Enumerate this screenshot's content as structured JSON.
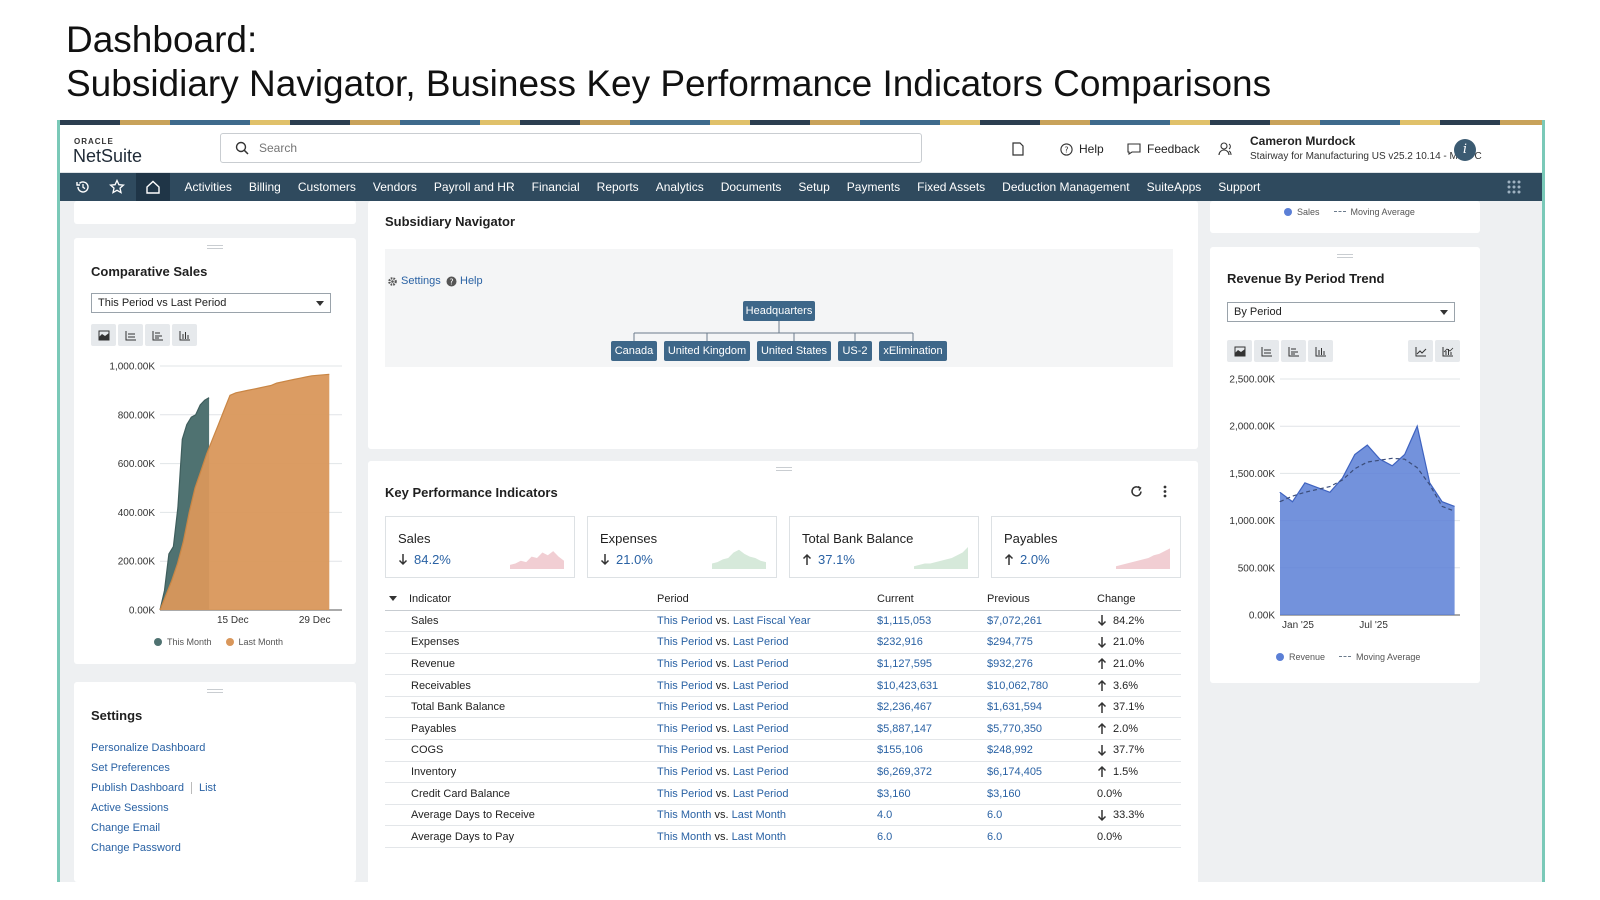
{
  "slide": {
    "title_line1": "Dashboard:",
    "title_line2": "Subsidiary Navigator, Business Key Performance Indicators Comparisons"
  },
  "header": {
    "brand_small": "ORACLE",
    "brand": "NetSuite",
    "search_placeholder": "Search",
    "help_label": "Help",
    "feedback_label": "Feedback",
    "user_name": "Cameron Murdock",
    "user_context": "Stairway for Manufacturing US v25.2 10.14 - MFG C"
  },
  "nav": {
    "items": [
      "Activities",
      "Billing",
      "Customers",
      "Vendors",
      "Payroll and HR",
      "Financial",
      "Reports",
      "Analytics",
      "Documents",
      "Setup",
      "Payments",
      "Fixed Assets",
      "Deduction Management",
      "SuiteApps",
      "Support"
    ]
  },
  "comparative_sales": {
    "title": "Comparative Sales",
    "filter": "This Period vs Last Period",
    "legend": [
      "This Month",
      "Last Month"
    ],
    "colors": {
      "this_month": "#4f7271",
      "last_month": "#d9975b"
    }
  },
  "chart_data": [
    {
      "type": "area",
      "title": "Comparative Sales",
      "y_ticks": [
        "1,000.00K",
        "800.00K",
        "600.00K",
        "400.00K",
        "200.00K",
        "0.00K"
      ],
      "x_ticks": [
        "15 Dec",
        "29 Dec"
      ],
      "ylim": [
        0,
        1000
      ],
      "series": [
        {
          "name": "This Month",
          "values": [
            0,
            80,
            230,
            260,
            420,
            700,
            760,
            790,
            800,
            840,
            860,
            870
          ]
        },
        {
          "name": "Last Month",
          "values": [
            0,
            60,
            120,
            190,
            280,
            400,
            500,
            570,
            640,
            700,
            760,
            820,
            880,
            890,
            895,
            900,
            905,
            910,
            915,
            920,
            930,
            935,
            940,
            945,
            950,
            955,
            960,
            962,
            964,
            966
          ]
        }
      ]
    },
    {
      "type": "area",
      "title": "Revenue By Period Trend",
      "y_ticks": [
        "2,500.00K",
        "2,000.00K",
        "1,500.00K",
        "1,000.00K",
        "500.00K",
        "0.00K"
      ],
      "x_ticks": [
        "Jan '25",
        "Jul '25"
      ],
      "ylim": [
        0,
        2500
      ],
      "series": [
        {
          "name": "Revenue",
          "values": [
            1300,
            1200,
            1400,
            1350,
            1300,
            1450,
            1700,
            1800,
            1650,
            1580,
            1700,
            2000,
            1400,
            1200,
            1150
          ]
        },
        {
          "name": "Moving Average",
          "values": [
            1200,
            1260,
            1300,
            1330,
            1360,
            1430,
            1550,
            1620,
            1640,
            1660,
            1650,
            1560,
            1380,
            1150,
            1100
          ]
        }
      ]
    }
  ],
  "top_legend": [
    "Sales",
    "Moving Average"
  ],
  "settings": {
    "title": "Settings",
    "links": [
      "Personalize Dashboard",
      "Set Preferences",
      "Publish Dashboard",
      "List",
      "Active Sessions",
      "Change Email",
      "Change Password"
    ]
  },
  "subsidiary": {
    "title": "Subsidiary Navigator",
    "settings_link": "Settings",
    "help_link": "Help",
    "root": "Headquarters",
    "children": [
      "Canada",
      "United Kingdom",
      "United States",
      "US-2",
      "xElimination"
    ]
  },
  "kpi": {
    "title": "Key Performance Indicators",
    "cards": [
      {
        "name": "Sales",
        "value": "84.2%",
        "dir": "down",
        "color": "#c93a4e"
      },
      {
        "name": "Expenses",
        "value": "21.0%",
        "dir": "down",
        "color": "#5aa86a"
      },
      {
        "name": "Total Bank Balance",
        "value": "37.1%",
        "dir": "up",
        "color": "#5aa86a"
      },
      {
        "name": "Payables",
        "value": "2.0%",
        "dir": "up",
        "color": "#c93a4e"
      }
    ],
    "columns": [
      "Indicator",
      "Period",
      "Current",
      "Previous",
      "Change"
    ],
    "vs": "vs.",
    "rows": [
      {
        "indicator": "Sales",
        "p1": "This Period",
        "p2": "Last Fiscal Year",
        "current": "$1,115,053",
        "previous": "$7,072,261",
        "dir": "down",
        "change": "84.2%"
      },
      {
        "indicator": "Expenses",
        "p1": "This Period",
        "p2": "Last Period",
        "current": "$232,916",
        "previous": "$294,775",
        "dir": "down",
        "change": "21.0%"
      },
      {
        "indicator": "Revenue",
        "p1": "This Period",
        "p2": "Last Period",
        "current": "$1,127,595",
        "previous": "$932,276",
        "dir": "up",
        "change": "21.0%"
      },
      {
        "indicator": "Receivables",
        "p1": "This Period",
        "p2": "Last Period",
        "current": "$10,423,631",
        "previous": "$10,062,780",
        "dir": "up",
        "change": "3.6%"
      },
      {
        "indicator": "Total Bank Balance",
        "p1": "This Period",
        "p2": "Last Period",
        "current": "$2,236,467",
        "previous": "$1,631,594",
        "dir": "up",
        "change": "37.1%"
      },
      {
        "indicator": "Payables",
        "p1": "This Period",
        "p2": "Last Period",
        "current": "$5,887,147",
        "previous": "$5,770,350",
        "dir": "up",
        "change": "2.0%"
      },
      {
        "indicator": "COGS",
        "p1": "This Period",
        "p2": "Last Period",
        "current": "$155,106",
        "previous": "$248,992",
        "dir": "down",
        "change": "37.7%"
      },
      {
        "indicator": "Inventory",
        "p1": "This Period",
        "p2": "Last Period",
        "current": "$6,269,372",
        "previous": "$6,174,405",
        "dir": "up",
        "change": "1.5%"
      },
      {
        "indicator": "Credit Card Balance",
        "p1": "This Period",
        "p2": "Last Period",
        "current": "$3,160",
        "previous": "$3,160",
        "dir": "none",
        "change": "0.0%"
      },
      {
        "indicator": "Average Days to Receive",
        "p1": "This Month",
        "p2": "Last Month",
        "current": "4.0",
        "previous": "6.0",
        "dir": "down",
        "change": "33.3%"
      },
      {
        "indicator": "Average Days to Pay",
        "p1": "This Month",
        "p2": "Last Month",
        "current": "6.0",
        "previous": "6.0",
        "dir": "none",
        "change": "0.0%"
      }
    ]
  },
  "revenue_trend": {
    "title": "Revenue By Period Trend",
    "filter": "By Period",
    "legend": [
      "Revenue",
      "Moving Average"
    ],
    "color": "#5b7fd6"
  }
}
